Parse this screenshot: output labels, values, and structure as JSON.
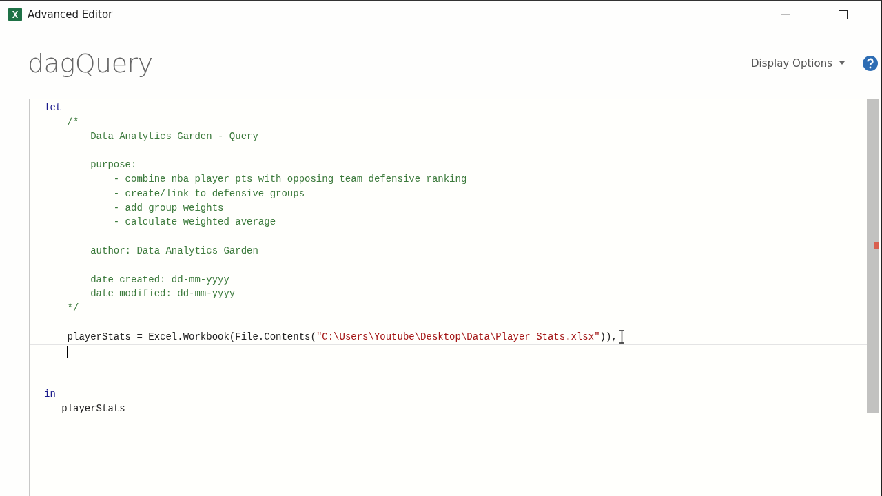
{
  "window": {
    "title": "Advanced Editor"
  },
  "query_name": "dagQuery",
  "display_options": {
    "label": "Display Options"
  },
  "editor": {
    "lines": [
      {
        "kind": "code",
        "current": false,
        "segments": [
          {
            "kind": "keyword",
            "text": "let"
          }
        ]
      },
      {
        "kind": "code",
        "current": false,
        "segments": [
          {
            "kind": "comment",
            "text": "    /*"
          }
        ]
      },
      {
        "kind": "code",
        "current": false,
        "segments": [
          {
            "kind": "comment",
            "text": "        Data Analytics Garden - Query"
          }
        ]
      },
      {
        "kind": "blank",
        "current": false
      },
      {
        "kind": "code",
        "current": false,
        "segments": [
          {
            "kind": "comment",
            "text": "        purpose:"
          }
        ]
      },
      {
        "kind": "code",
        "current": false,
        "segments": [
          {
            "kind": "comment",
            "text": "            - combine nba player pts with opposing team defensive ranking"
          }
        ]
      },
      {
        "kind": "code",
        "current": false,
        "segments": [
          {
            "kind": "comment",
            "text": "            - create/link to defensive groups"
          }
        ]
      },
      {
        "kind": "code",
        "current": false,
        "segments": [
          {
            "kind": "comment",
            "text": "            - add group weights"
          }
        ]
      },
      {
        "kind": "code",
        "current": false,
        "segments": [
          {
            "kind": "comment",
            "text": "            - calculate weighted average"
          }
        ]
      },
      {
        "kind": "blank",
        "current": false
      },
      {
        "kind": "code",
        "current": false,
        "segments": [
          {
            "kind": "comment",
            "text": "        author: Data Analytics Garden"
          }
        ]
      },
      {
        "kind": "blank",
        "current": false
      },
      {
        "kind": "code",
        "current": false,
        "segments": [
          {
            "kind": "comment",
            "text": "        date created: dd-mm-yyyy"
          }
        ]
      },
      {
        "kind": "code",
        "current": false,
        "segments": [
          {
            "kind": "comment",
            "text": "        date modified: dd-mm-yyyy"
          }
        ]
      },
      {
        "kind": "code",
        "current": false,
        "segments": [
          {
            "kind": "comment",
            "text": "    */"
          }
        ]
      },
      {
        "kind": "blank",
        "current": false
      },
      {
        "kind": "code",
        "current": false,
        "segments": [
          {
            "kind": "plain",
            "text": "    playerStats = Excel.Workbook(File.Contents("
          },
          {
            "kind": "string",
            "text": "\"C:\\Users\\Youtube\\Desktop\\Data\\Player Stats.xlsx\""
          },
          {
            "kind": "plain",
            "text": ")),"
          }
        ]
      },
      {
        "kind": "blank",
        "current": true
      },
      {
        "kind": "blank",
        "current": false
      },
      {
        "kind": "blank",
        "current": false
      },
      {
        "kind": "code",
        "current": false,
        "segments": [
          {
            "kind": "keyword",
            "text": "in"
          }
        ]
      },
      {
        "kind": "code",
        "current": false,
        "segments": [
          {
            "kind": "plain",
            "text": "   playerStats"
          }
        ]
      }
    ]
  }
}
